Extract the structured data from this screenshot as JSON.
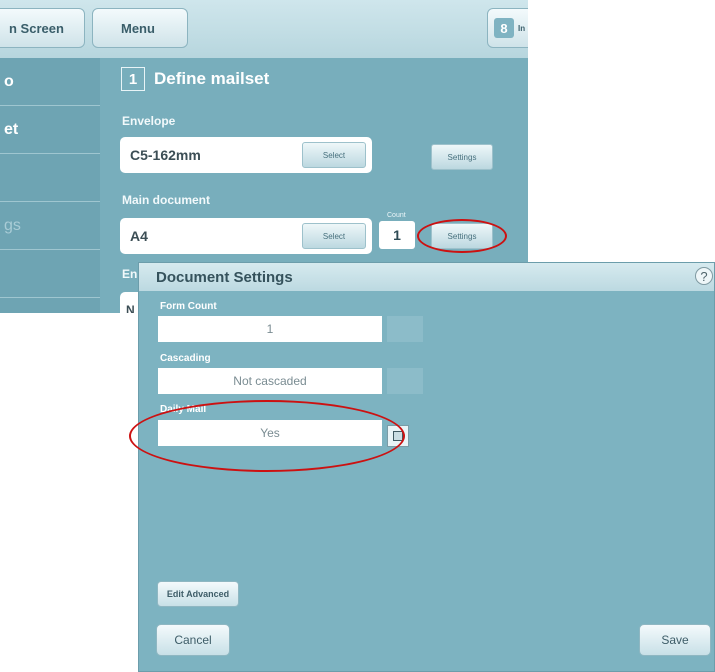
{
  "topbar": {
    "home_label": "n Screen",
    "menu_label": "Menu",
    "user_glyph": "8",
    "user_text": "In"
  },
  "sidebar": {
    "items": [
      {
        "label": "o"
      },
      {
        "label": "et"
      },
      {
        "label": ""
      },
      {
        "label": "gs"
      },
      {
        "label": ""
      }
    ]
  },
  "mailset": {
    "step_number": "1",
    "title": "Define mailset",
    "envelope": {
      "label": "Envelope",
      "value": "C5-162mm",
      "select_label": "Select",
      "settings_label": "Settings"
    },
    "main_document": {
      "label": "Main document",
      "value": "A4",
      "select_label": "Select",
      "count_label": "Count",
      "count_value": "1",
      "settings_label": "Settings"
    },
    "next_label": "En",
    "next_value": "N"
  },
  "dialog": {
    "title": "Document Settings",
    "help_glyph": "?",
    "form_count": {
      "label": "Form Count",
      "value": "1"
    },
    "cascading": {
      "label": "Cascading",
      "value": "Not cascaded"
    },
    "daily_mail": {
      "label": "Daily Mail",
      "value": "Yes"
    },
    "edit_advanced_label": "Edit Advanced",
    "cancel_label": "Cancel",
    "save_label": "Save"
  },
  "colors": {
    "background": "#78aebc",
    "dialog_background": "#7db3c1",
    "highlight_circle": "#cc1111"
  },
  "icons": {
    "help": "help-icon",
    "user": "user-icon",
    "edit": "edit-icon"
  }
}
